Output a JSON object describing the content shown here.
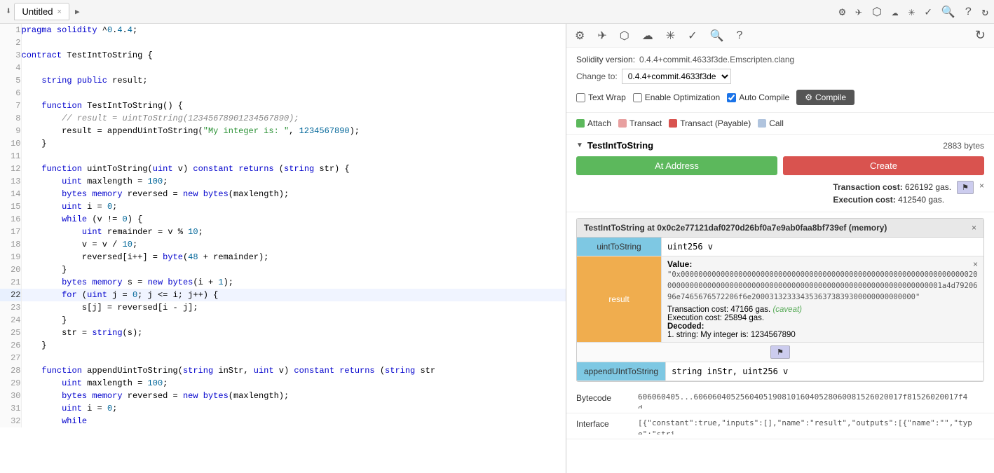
{
  "tab": {
    "title": "Untitled",
    "close": "×"
  },
  "topIcons": {
    "settings": "⚙",
    "send": "✈",
    "cube": "⬡",
    "cloud": "☁",
    "bug": "✳",
    "check": "✓",
    "search": "🔍",
    "help": "?",
    "sync": "↻"
  },
  "version": {
    "label": "Solidity version:",
    "value": "0.4.4+commit.4633f3de.Emscripten.clang",
    "changeLabel": "Change to:",
    "changeValue": "0.4.4+commit.4633f3de",
    "options": {
      "textWrap": "Text Wrap",
      "enableOpt": "Enable Optimization",
      "autoCompile": "Auto Compile"
    },
    "compileBtn": "Compile",
    "compileIcon": "⚙"
  },
  "legend": [
    {
      "color": "#5cb85c",
      "label": "Attach"
    },
    {
      "color": "#e8a0a0",
      "label": "Transact"
    },
    {
      "color": "#d9534f",
      "label": "Transact (Payable)"
    },
    {
      "color": "#b0c4de",
      "label": "Call"
    }
  ],
  "contract": {
    "name": "TestIntToString",
    "bytes": "2883 bytes",
    "atAddressBtn": "At Address",
    "createBtn": "Create",
    "txCostLabel": "Transaction cost:",
    "txCostValue": "626192 gas.",
    "execCostLabel": "Execution cost:",
    "execCostValue": "412540 gas."
  },
  "deployed": {
    "title": "TestIntToString at 0x0c2e77121daf0270d26bf0a7e9ab0faa8bf739ef (memory)",
    "functions": [
      {
        "name": "uintToString",
        "type": "blue",
        "input": "uint256 v"
      },
      {
        "name": "result",
        "type": "orange"
      },
      {
        "name": "appendUIntToString",
        "type": "blue",
        "input": "string inStr, uint256 v"
      }
    ],
    "result": {
      "label": "Value:",
      "value": "\"0x000000000000000000000000000000000000000000000000000000000000000002000000000000000000000000000000000000000000000000000000000000001a4d7920696e7465676572206f6e2000313233343536373839300000000000000\"",
      "txCost": "Transaction cost: 47166 gas.",
      "caveat": "(caveat)",
      "execCost": "Execution cost: 25894 gas.",
      "decoded": "Decoded:",
      "decodedValue": "1. string: My integer is: 1234567890"
    }
  },
  "bytecode": {
    "label": "Bytecode",
    "value": "606060405...606060405256040519081016040528060081526020017f81526020017f4d..."
  },
  "interface": {
    "label": "Interface",
    "value": "[{\"constant\":true,\"inputs\":[],\"name\":\"result\",\"outputs\":[{\"name\":\"\",\"type\":\"stri..."
  },
  "code": [
    {
      "num": 1,
      "text": "pragma solidity ^0.4.4;",
      "highlighted": false
    },
    {
      "num": 2,
      "text": "",
      "highlighted": false
    },
    {
      "num": 3,
      "text": "contract TestIntToString {",
      "highlighted": false
    },
    {
      "num": 4,
      "text": "",
      "highlighted": false
    },
    {
      "num": 5,
      "text": "    string public result;",
      "highlighted": false
    },
    {
      "num": 6,
      "text": "",
      "highlighted": false
    },
    {
      "num": 7,
      "text": "    function TestIntToString() {",
      "highlighted": false
    },
    {
      "num": 8,
      "text": "        // result = uintToString(12345678901234567890);",
      "highlighted": false
    },
    {
      "num": 9,
      "text": "        result = appendUintToString(\"My integer is: \", 1234567890);",
      "highlighted": false
    },
    {
      "num": 10,
      "text": "    }",
      "highlighted": false
    },
    {
      "num": 11,
      "text": "",
      "highlighted": false
    },
    {
      "num": 12,
      "text": "    function uintToString(uint v) constant returns (string str) {",
      "highlighted": false
    },
    {
      "num": 13,
      "text": "        uint maxlength = 100;",
      "highlighted": false
    },
    {
      "num": 14,
      "text": "        bytes memory reversed = new bytes(maxlength);",
      "highlighted": false
    },
    {
      "num": 15,
      "text": "        uint i = 0;",
      "highlighted": false
    },
    {
      "num": 16,
      "text": "        while (v != 0) {",
      "highlighted": false
    },
    {
      "num": 17,
      "text": "            uint remainder = v % 10;",
      "highlighted": false
    },
    {
      "num": 18,
      "text": "            v = v / 10;",
      "highlighted": false
    },
    {
      "num": 19,
      "text": "            reversed[i++] = byte(48 + remainder);",
      "highlighted": false
    },
    {
      "num": 20,
      "text": "        }",
      "highlighted": false
    },
    {
      "num": 21,
      "text": "        bytes memory s = new bytes(i + 1);",
      "highlighted": false
    },
    {
      "num": 22,
      "text": "        for (uint j = 0; j <= i; j++) {",
      "highlighted": true
    },
    {
      "num": 23,
      "text": "            s[j] = reversed[i - j];",
      "highlighted": false
    },
    {
      "num": 24,
      "text": "        }",
      "highlighted": false
    },
    {
      "num": 25,
      "text": "        str = string(s);",
      "highlighted": false
    },
    {
      "num": 26,
      "text": "    }",
      "highlighted": false
    },
    {
      "num": 27,
      "text": "",
      "highlighted": false
    },
    {
      "num": 28,
      "text": "    function appendUintToString(string inStr, uint v) constant returns (string str",
      "highlighted": false
    },
    {
      "num": 29,
      "text": "        uint maxlength = 100;",
      "highlighted": false
    },
    {
      "num": 30,
      "text": "        bytes memory reversed = new bytes(maxlength);",
      "highlighted": false
    },
    {
      "num": 31,
      "text": "        uint i = 0;",
      "highlighted": false
    },
    {
      "num": 32,
      "text": "        while",
      "highlighted": false
    }
  ]
}
